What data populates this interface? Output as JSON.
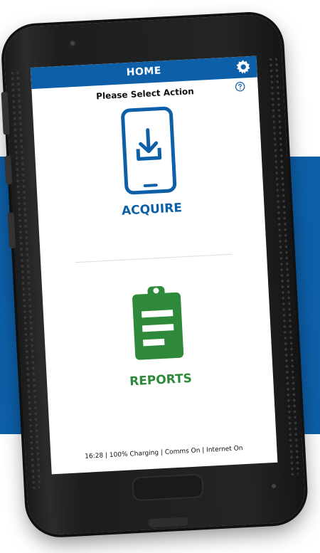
{
  "header": {
    "title": "HOME"
  },
  "prompt": "Please Select Action",
  "actions": [
    {
      "label": "ACQUIRE",
      "icon": "phone-download-icon",
      "color": "#0d5fa8"
    },
    {
      "label": "REPORTS",
      "icon": "clipboard-icon",
      "color": "#2e8a3a"
    }
  ],
  "status": "16:28 | 100%  Charging | Comms On | Internet On",
  "colors": {
    "primary": "#0d5fa8",
    "reports": "#2e8a3a",
    "device": "#1b1b1b"
  }
}
